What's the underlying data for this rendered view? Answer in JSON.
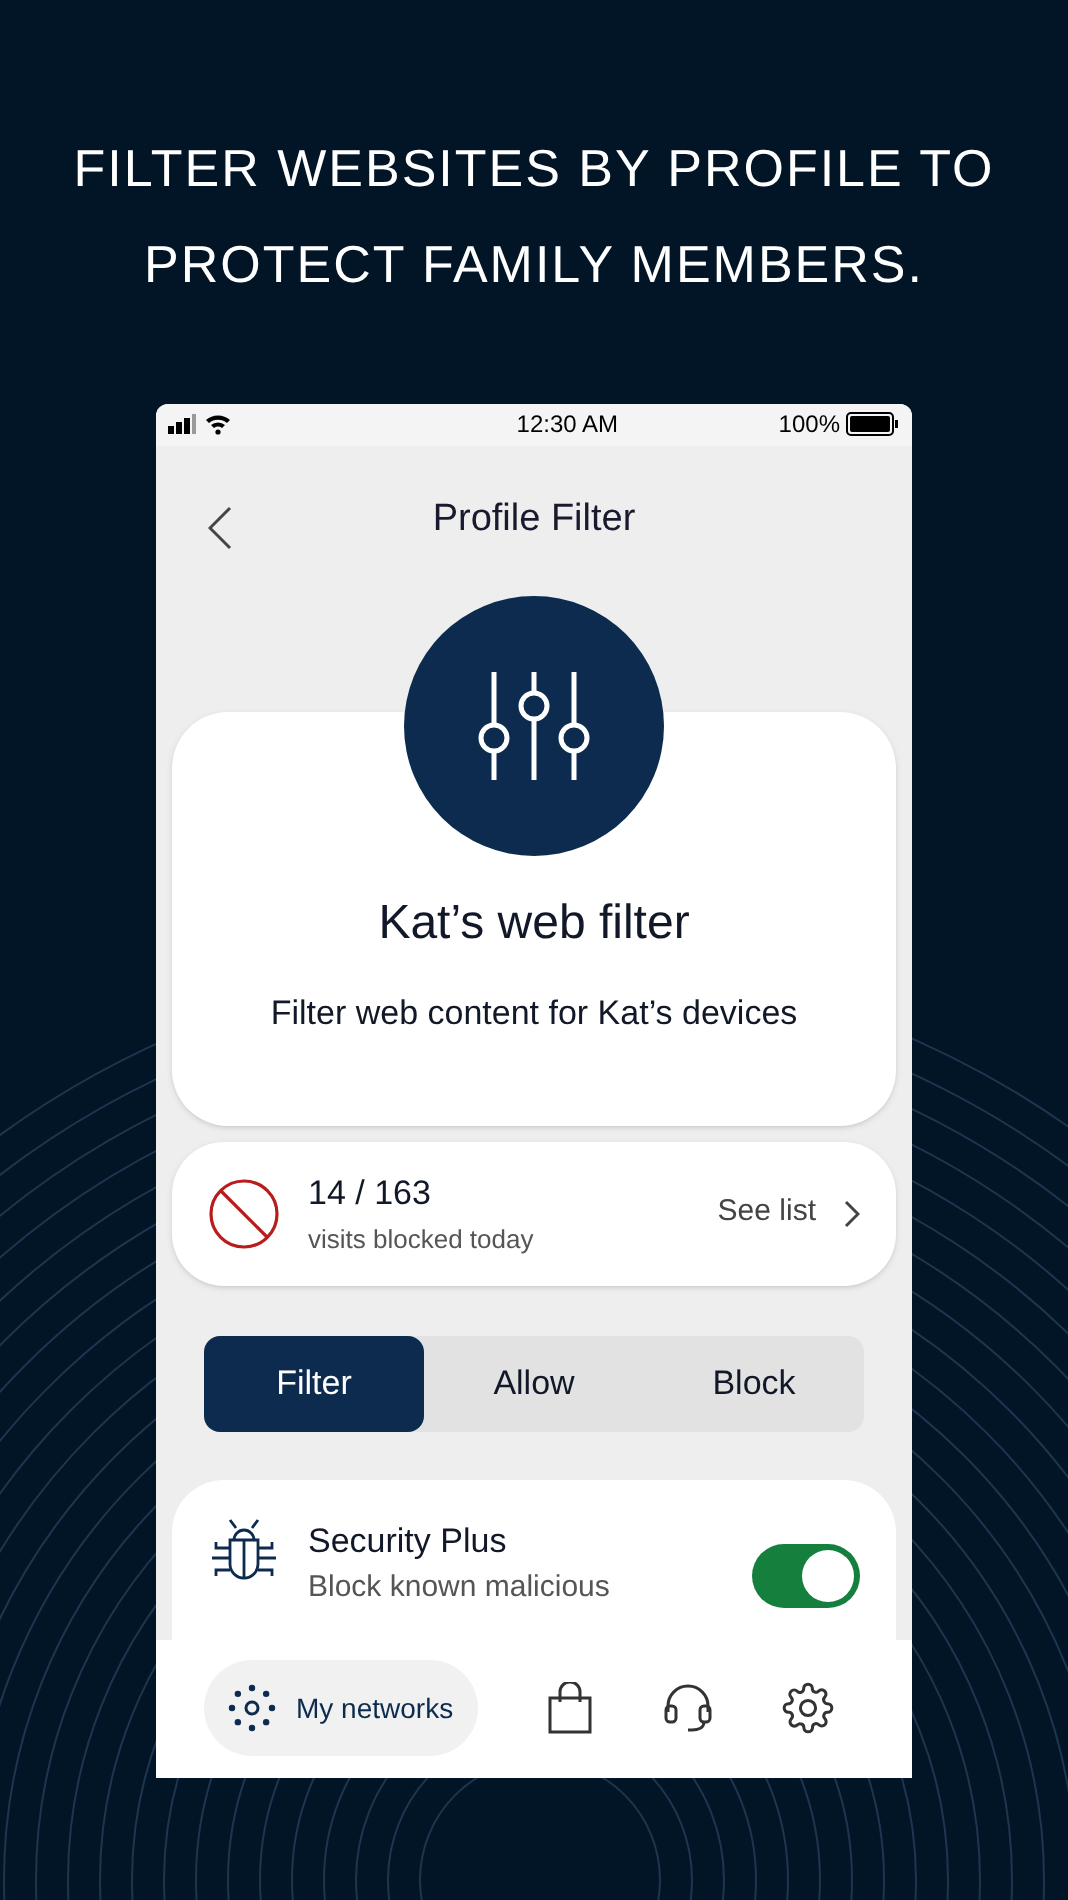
{
  "headline": "FILTER WEBSITES BY PROFILE TO PROTECT FAMILY MEMBERS.",
  "status_bar": {
    "time": "12:30 AM",
    "battery": "100%"
  },
  "header": {
    "title": "Profile Filter"
  },
  "profile": {
    "title": "Kat’s web filter",
    "subtitle": "Filter web content for Kat’s devices"
  },
  "blocked": {
    "count": "14 / 163",
    "caption": "visits blocked today",
    "link": "See list"
  },
  "tabs": [
    {
      "label": "Filter",
      "selected": true
    },
    {
      "label": "Allow",
      "selected": false
    },
    {
      "label": "Block",
      "selected": false
    }
  ],
  "feature": {
    "title": "Security Plus",
    "description": "Block known malicious",
    "on": true
  },
  "bottom_nav": [
    {
      "kind": "networks",
      "label": "My networks",
      "selected": true
    },
    {
      "kind": "shop",
      "selected": false
    },
    {
      "kind": "support",
      "selected": false
    },
    {
      "kind": "settings",
      "selected": false
    }
  ]
}
